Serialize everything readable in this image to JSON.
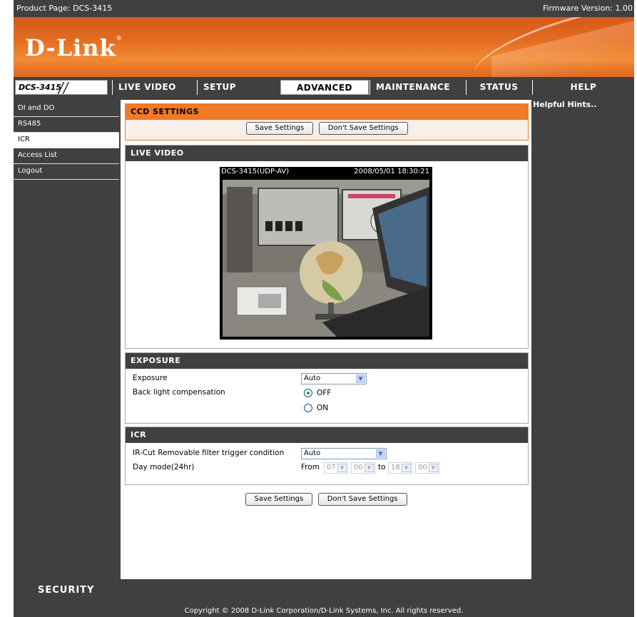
{
  "topbar": {
    "product": "Product Page: DCS-3415",
    "firmware": "Firmware Version: 1.00"
  },
  "banner": {
    "logo": "D-Link"
  },
  "nav": {
    "model": "DCS-3415",
    "tabs": [
      "LIVE VIDEO",
      "SETUP",
      "ADVANCED",
      "MAINTENANCE",
      "STATUS",
      "HELP"
    ],
    "active_tab": "ADVANCED"
  },
  "sidebar": {
    "items": [
      {
        "label": "DI and DO"
      },
      {
        "label": "RS485"
      },
      {
        "label": "ICR"
      },
      {
        "label": "Access List"
      },
      {
        "label": "Logout"
      }
    ],
    "active": "ICR"
  },
  "ccd": {
    "title": "CCD SETTINGS",
    "save_label": "Save Settings",
    "dont_save_label": "Don't Save Settings"
  },
  "live_video": {
    "title": "LIVE VIDEO",
    "camera_name": "DCS-3415(UDP-AV)",
    "timestamp": "2008/05/01 18:30:21"
  },
  "exposure": {
    "title": "EXPOSURE",
    "exposure_label": "Exposure",
    "exposure_value": "Auto",
    "blc_label": "Back light compensation",
    "off_label": "OFF",
    "on_label": "ON",
    "blc_selected": "OFF"
  },
  "icr": {
    "title": "ICR",
    "trigger_label": "IR-Cut Removable filter trigger condition",
    "trigger_value": "Auto",
    "day_mode_label": "Day mode(24hr)",
    "from_label": "From",
    "to_label": "to",
    "from_hour": "07",
    "from_min": "00",
    "to_hour": "18",
    "to_min": "00"
  },
  "bottom_buttons": {
    "save_label": "Save Settings",
    "dont_save_label": "Don't Save Settings"
  },
  "hints": {
    "title": "Helpful Hints.."
  },
  "footer": {
    "security": "SECURITY",
    "copyright": "Copyright © 2008 D-Link Corporation/D-Link Systems, Inc. All rights reserved."
  }
}
